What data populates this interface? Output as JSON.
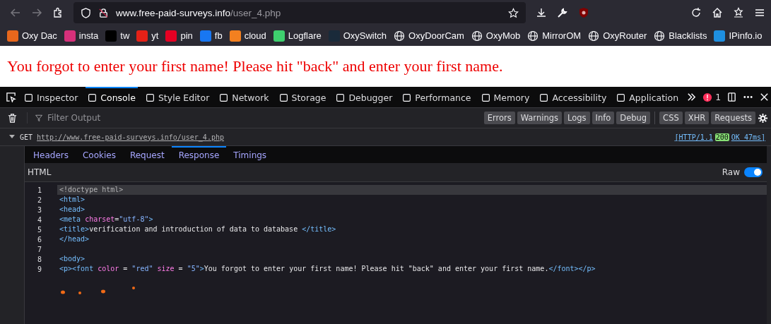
{
  "address_bar": {
    "host": "www.free-paid-surveys.info",
    "path": "/user_4.php"
  },
  "bookmarks": [
    {
      "label": "Oxy Dac",
      "kind": "logo",
      "color": "#e8671c"
    },
    {
      "label": "insta",
      "kind": "logo",
      "color": "#d6307a"
    },
    {
      "label": "tw",
      "kind": "logo",
      "color": "#000000"
    },
    {
      "label": "yt",
      "kind": "logo",
      "color": "#e62117"
    },
    {
      "label": "pin",
      "kind": "logo",
      "color": "#e60023"
    },
    {
      "label": "fb",
      "kind": "logo",
      "color": "#1877f2"
    },
    {
      "label": "cloud",
      "kind": "logo",
      "color": "#f38020"
    },
    {
      "label": "Logflare",
      "kind": "logo",
      "color": "#3ecf6e"
    },
    {
      "label": "OxySwitch",
      "kind": "logo",
      "color": "#1a2a3a"
    },
    {
      "label": "OxyDoorCam",
      "kind": "globe"
    },
    {
      "label": "OxyMob",
      "kind": "globe"
    },
    {
      "label": "MirrorOM",
      "kind": "globe"
    },
    {
      "label": "OxyRouter",
      "kind": "globe"
    },
    {
      "label": "Blacklists",
      "kind": "globe"
    },
    {
      "label": "IPinfo.io",
      "kind": "logo",
      "color": "#1e8fe0"
    }
  ],
  "page_message": "You forgot to enter your first name! Please hit \"back\" and enter your first name.",
  "devtools_tabs": [
    {
      "label": "Inspector",
      "selected": false
    },
    {
      "label": "Console",
      "selected": true
    },
    {
      "label": "Style Editor",
      "selected": false
    },
    {
      "label": "Network",
      "selected": false
    },
    {
      "label": "Storage",
      "selected": false
    },
    {
      "label": "Debugger",
      "selected": false
    },
    {
      "label": "Performance",
      "selected": false
    },
    {
      "label": "Memory",
      "selected": false
    },
    {
      "label": "Accessibility",
      "selected": false
    },
    {
      "label": "Application",
      "selected": false
    }
  ],
  "error_count": "1",
  "filter": {
    "placeholder": "Filter Output"
  },
  "filter_buttons": [
    "Errors",
    "Warnings",
    "Logs",
    "Info",
    "Debug"
  ],
  "type_buttons": [
    "CSS",
    "XHR",
    "Requests"
  ],
  "request": {
    "method": "GET",
    "url": "http://www.free-paid-surveys.info/user_4.php",
    "protocol": "[HTTP/1.1",
    "status": "200",
    "status_text": "OK 47ms]"
  },
  "detail_tabs": [
    {
      "label": "Headers",
      "selected": false
    },
    {
      "label": "Cookies",
      "selected": false
    },
    {
      "label": "Request",
      "selected": false
    },
    {
      "label": "Response",
      "selected": true
    },
    {
      "label": "Timings",
      "selected": false
    }
  ],
  "response_header": "HTML",
  "raw": {
    "label": "Raw",
    "on": true
  },
  "code_lines": [
    {
      "number": "1",
      "selected": true,
      "tokens": [
        {
          "kind": "doctype",
          "text": "<!doctype html>"
        }
      ]
    },
    {
      "number": "2",
      "selected": false,
      "tokens": [
        {
          "kind": "tag",
          "text": "<html>"
        }
      ]
    },
    {
      "number": "3",
      "selected": false,
      "tokens": [
        {
          "kind": "tag",
          "text": "<head>"
        }
      ]
    },
    {
      "number": "4",
      "selected": false,
      "tokens": [
        {
          "kind": "tag",
          "text": "<meta "
        },
        {
          "kind": "attr",
          "text": "charset"
        },
        {
          "kind": "text",
          "text": "="
        },
        {
          "kind": "string",
          "text": "\"utf-8\""
        },
        {
          "kind": "tag",
          "text": ">"
        }
      ]
    },
    {
      "number": "5",
      "selected": false,
      "tokens": [
        {
          "kind": "tag",
          "text": "<title>"
        },
        {
          "kind": "text",
          "text": "verification and introduction of data to database "
        },
        {
          "kind": "tag",
          "text": "</title>"
        }
      ]
    },
    {
      "number": "6",
      "selected": false,
      "tokens": [
        {
          "kind": "tag",
          "text": "</head>"
        }
      ]
    },
    {
      "number": "7",
      "selected": false
    },
    {
      "number": "8",
      "selected": false,
      "tokens": [
        {
          "kind": "tag",
          "text": "<body>"
        }
      ]
    },
    {
      "number": "9",
      "selected": false,
      "tokens": [
        {
          "kind": "tag",
          "text": "<p><font "
        },
        {
          "kind": "attr",
          "text": "color"
        },
        {
          "kind": "text",
          "text": " = "
        },
        {
          "kind": "string",
          "text": "\"red\""
        },
        {
          "kind": "attr",
          "text": " size"
        },
        {
          "kind": "text",
          "text": " = "
        },
        {
          "kind": "string",
          "text": "\"5\""
        },
        {
          "kind": "tag",
          "text": ">"
        },
        {
          "kind": "text",
          "text": "You forgot to enter your first name! Please hit \"back\" and enter your first name."
        },
        {
          "kind": "tag",
          "text": "</font></p>"
        }
      ]
    }
  ]
}
